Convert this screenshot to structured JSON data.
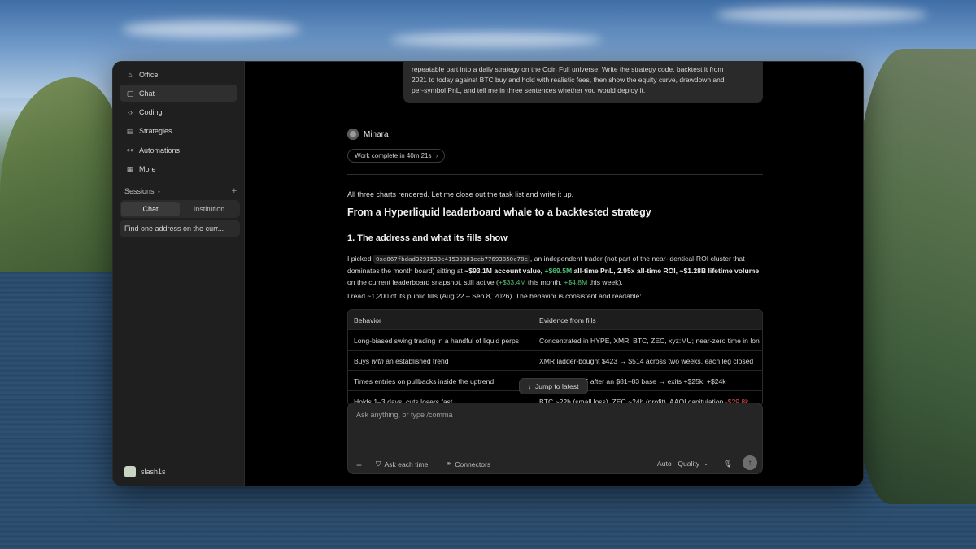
{
  "sidebar": {
    "items": [
      {
        "label": "Office",
        "icon": "office-icon"
      },
      {
        "label": "Chat",
        "icon": "chat-icon"
      },
      {
        "label": "Coding",
        "icon": "code-icon"
      },
      {
        "label": "Strategies",
        "icon": "strategies-icon"
      },
      {
        "label": "Automations",
        "icon": "automations-icon"
      },
      {
        "label": "More",
        "icon": "grid-icon"
      }
    ],
    "sessions_label": "Sessions",
    "segments": [
      "Chat",
      "Institution"
    ],
    "session_item": "Find one address on the curr...",
    "user": "slash1s"
  },
  "message": {
    "line1": "repeatable part into a daily strategy on the Coin Full universe. Write the strategy code, backtest it from",
    "line2": "2021 to today against BTC buy and hold with realistic fees, then show the equity curve, drawdown and",
    "line3": "per-symbol PnL, and tell me in three sentences whether you would deploy it."
  },
  "assistant": {
    "name": "Minara",
    "work_status": "Work complete in 40m 21s",
    "intro": "All three charts rendered. Let me close out the task list and write it up.",
    "title": "From a Hyperliquid leaderboard whale to a backtested strategy",
    "section": "1. The address and what its fills show",
    "p1_a": "I picked",
    "address": "0xe867fbdad3291530e41530301ecb77693850c78e",
    "p1_b": ", an independent trader (not part of the near-identical-ROI cluster that",
    "p1_c": "dominates the month board) sitting at",
    "p1_value": "~$93.1M account value",
    "p1_comma": ",",
    "p1_pnl": "+$69.5M",
    "p1_roi": "all-time PnL, 2.95x all-time ROI, ~$1.28B lifetime volume",
    "p1_d": "on the current leaderboard snapshot, still active (",
    "p1_month": "+$33.4M",
    "p1_e": "this month,",
    "p1_week": "+$4.8M",
    "p1_f": "this week).",
    "p2": "I read ~1,200 of its public fills (Aug 22 – Sep 8, 2026). The behavior is consistent and readable:"
  },
  "table": {
    "headers": [
      "Behavior",
      "Evidence from fills"
    ],
    "rows": [
      {
        "c1": "Long-biased swing trading in a handful of liquid perps",
        "c2": "Concentrated in HYPE, XMR, BTC, ZEC, xyz:MU; near-zero time in lon"
      },
      {
        "c1a": "Buys",
        "c1b": "with",
        "c1c": "an established trend",
        "c2": "XMR ladder-bought $423 → $514 across two weeks, each leg closed"
      },
      {
        "c1": "Times entries on pullbacks inside the uptrend",
        "c2": "9.3–79.5 after an $81–83 base → exits +$25k, +$24k"
      },
      {
        "c1": "Holds 1–3 days, cuts losers fast",
        "c2": "BTC ~22h (small loss), ZEC ~24h (profit), AAOI capitulation",
        "c2_red": "-$29.8k"
      }
    ]
  },
  "jump_label": "Jump to latest",
  "composer": {
    "placeholder": "Ask anything, or type /comma",
    "ask_label": "Ask each time",
    "connectors_label": "Connectors",
    "model_label": "Auto · Quality"
  }
}
